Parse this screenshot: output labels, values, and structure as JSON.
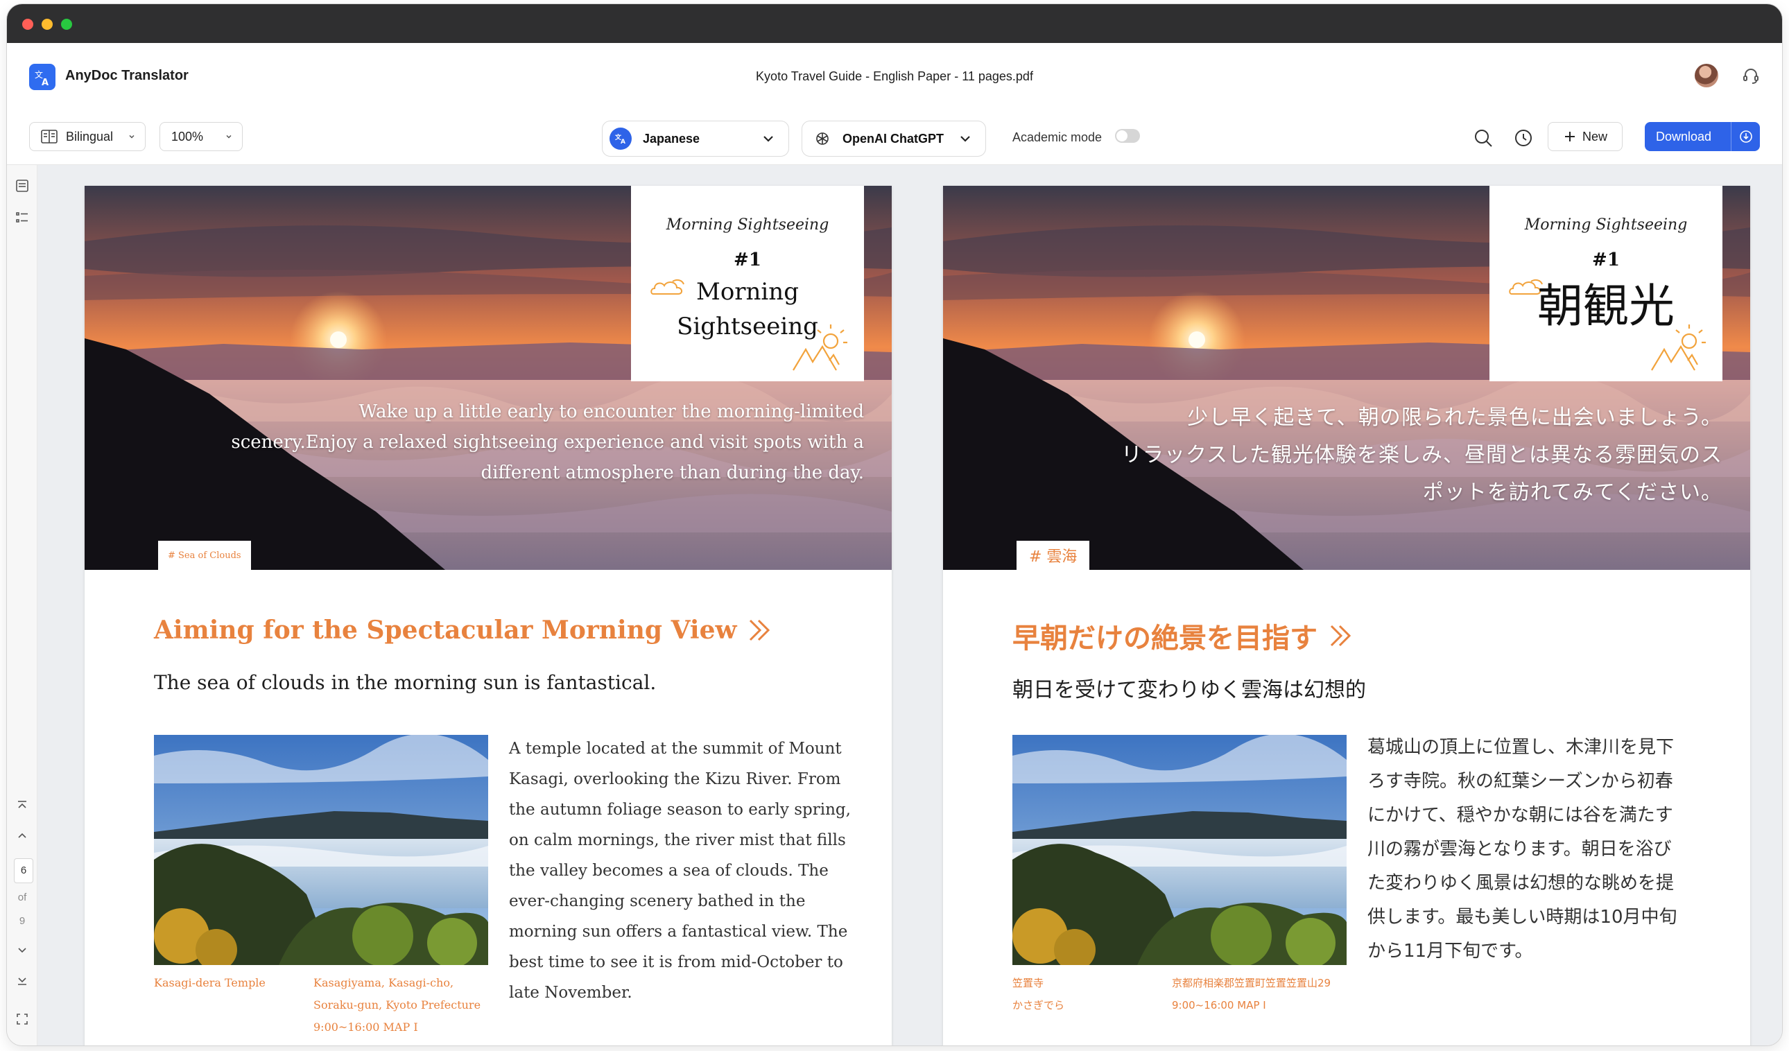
{
  "app": {
    "name": "AnyDoc Translator",
    "file_title": "Kyoto Travel Guide - English Paper - 11 pages.pdf"
  },
  "toolbar": {
    "view_mode": "Bilingual",
    "zoom": "100%",
    "target_language": "Japanese",
    "engine": "OpenAI ChatGPT",
    "academic_mode_label": "Academic mode",
    "academic_mode_on": false,
    "new_label": "New",
    "download_label": "Download"
  },
  "colors": {
    "accent": "#e8823e",
    "brand_blue": "#2e63e8",
    "titlebar": "#2f2f30"
  },
  "pager": {
    "current": "6",
    "of_label": "of",
    "total": "9"
  },
  "original": {
    "card_script": "Morning Sightseeing",
    "card_number": "#1",
    "card_title_line1": "Morning",
    "card_title_line2": "Sightseeing",
    "hero_line1": "Wake up a little early to encounter the morning-limited",
    "hero_line2": "scenery.Enjoy a relaxed sightseeing experience and visit spots with a",
    "hero_line3": "different atmosphere than during the day.",
    "tag": "# Sea of Clouds",
    "heading": "Aiming for the Spectacular Morning View",
    "subheading": "The sea of clouds in the morning sun is fantastical.",
    "body": "A temple located at the summit of Mount Kasagi, overlooking the Kizu River. From the autumn foliage season to early spring, on calm mornings, the river mist that fills the valley becomes a sea of clouds. The ever-changing scenery bathed in the morning sun offers a fantastical view. The best time to see it is from mid-October to late November.",
    "caption_name": "Kasagi-dera Temple",
    "caption_addr1": "Kasagiyama, Kasagi-cho,",
    "caption_addr2": "Soraku-gun, Kyoto Prefecture",
    "caption_hours": "9:00~16:00 MAP I"
  },
  "translated": {
    "card_script": "Morning Sightseeing",
    "card_number": "#1",
    "card_title": "朝観光",
    "hero_line1": "少し早く起きて、朝の限られた景色に出会いましょう。",
    "hero_line2": "リラックスした観光体験を楽しみ、昼間とは異なる雰囲気のス",
    "hero_line3": "ポットを訪れてみてください。",
    "tag": "# 雲海",
    "heading": "早朝だけの絶景を目指す",
    "subheading": "朝日を受けて変わりゆく雲海は幻想的",
    "body_line1": "葛城山の頂上に位置し、木津川を見下",
    "body_line2": "ろす寺院。秋の紅葉シーズンから初春",
    "body_line3": "にかけて、穏やかな朝には谷を満たす",
    "body_line4": "川の霧が雲海となります。朝日を浴び",
    "body_line5": "た変わりゆく風景は幻想的な眺めを提",
    "body_line6": "供します。最も美しい時期は10月中旬",
    "body_line7": "から11月下旬です。",
    "caption_name": "笠置寺",
    "caption_reading": "かさぎでら",
    "caption_addr": "京都府相楽郡笠置町笠置笠置山29",
    "caption_hours": "9:00~16:00 MAP I"
  }
}
